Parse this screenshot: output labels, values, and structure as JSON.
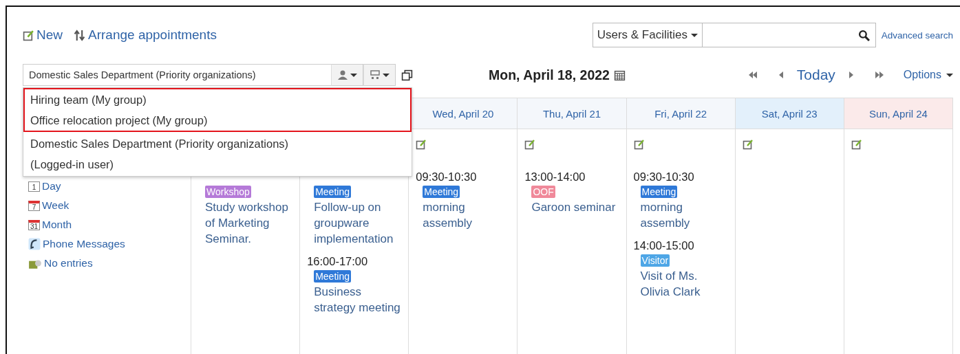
{
  "toolbar": {
    "new": "New",
    "arrange": "Arrange appointments"
  },
  "search": {
    "scope": "Users & Facilities",
    "advanced": "Advanced search"
  },
  "group_select": {
    "value": "Domestic Sales Department (Priority organizations)",
    "groups": [
      {
        "highlighted": true,
        "items": [
          "Hiring team (My group)",
          "Office relocation project (My group)"
        ]
      },
      {
        "highlighted": false,
        "items": [
          "Domestic Sales Department (Priority organizations)",
          "(Logged-in user)"
        ]
      }
    ]
  },
  "date": "Mon, April 18, 2022",
  "nav": {
    "today": "Today",
    "options": "Options"
  },
  "sidebar": [
    {
      "kind": "day",
      "label": "Day",
      "num": "1"
    },
    {
      "kind": "week",
      "label": "Week",
      "num": "7"
    },
    {
      "kind": "month",
      "label": "Month",
      "num": "31"
    },
    {
      "kind": "phone",
      "label": "Phone Messages"
    },
    {
      "kind": "entries",
      "label": "No entries"
    }
  ],
  "days": [
    {
      "events": [
        {
          "tag": "Workshop",
          "color": "#b57ad8",
          "title": "Study workshop of Marketing Seminar."
        }
      ]
    },
    {
      "events": [
        {
          "tag": "Meeting",
          "color": "#2f79d8",
          "title": "Follow-up on groupware implementation"
        },
        {
          "time": "16:00-17:00",
          "tag": "Meeting",
          "color": "#2f79d8",
          "title": "Business strategy meeting"
        }
      ]
    },
    {
      "kind": "weekday",
      "header": "Wed, April 20",
      "new_button": true,
      "events": [
        {
          "time": "09:30-10:30",
          "tag": "Meeting",
          "color": "#2f79d8",
          "title": "morning assembly"
        }
      ]
    },
    {
      "kind": "weekday",
      "header": "Thu, April 21",
      "new_button": true,
      "events": [
        {
          "time": "13:00-14:00",
          "tag": "OOF",
          "color": "#f0899a",
          "title": "Garoon seminar"
        }
      ]
    },
    {
      "kind": "weekday",
      "header": "Fri, April 22",
      "new_button": true,
      "events": [
        {
          "time": "09:30-10:30",
          "tag": "Meeting",
          "color": "#2f79d8",
          "title": "morning assembly"
        },
        {
          "time": "14:00-15:00",
          "tag": "Visitor",
          "color": "#4ea6e6",
          "title": "Visit of Ms. Olivia Clark"
        }
      ]
    },
    {
      "kind": "saturday",
      "header": "Sat, April 23",
      "new_button": true
    },
    {
      "kind": "sunday",
      "header": "Sun, April 24",
      "new_button": true
    }
  ]
}
